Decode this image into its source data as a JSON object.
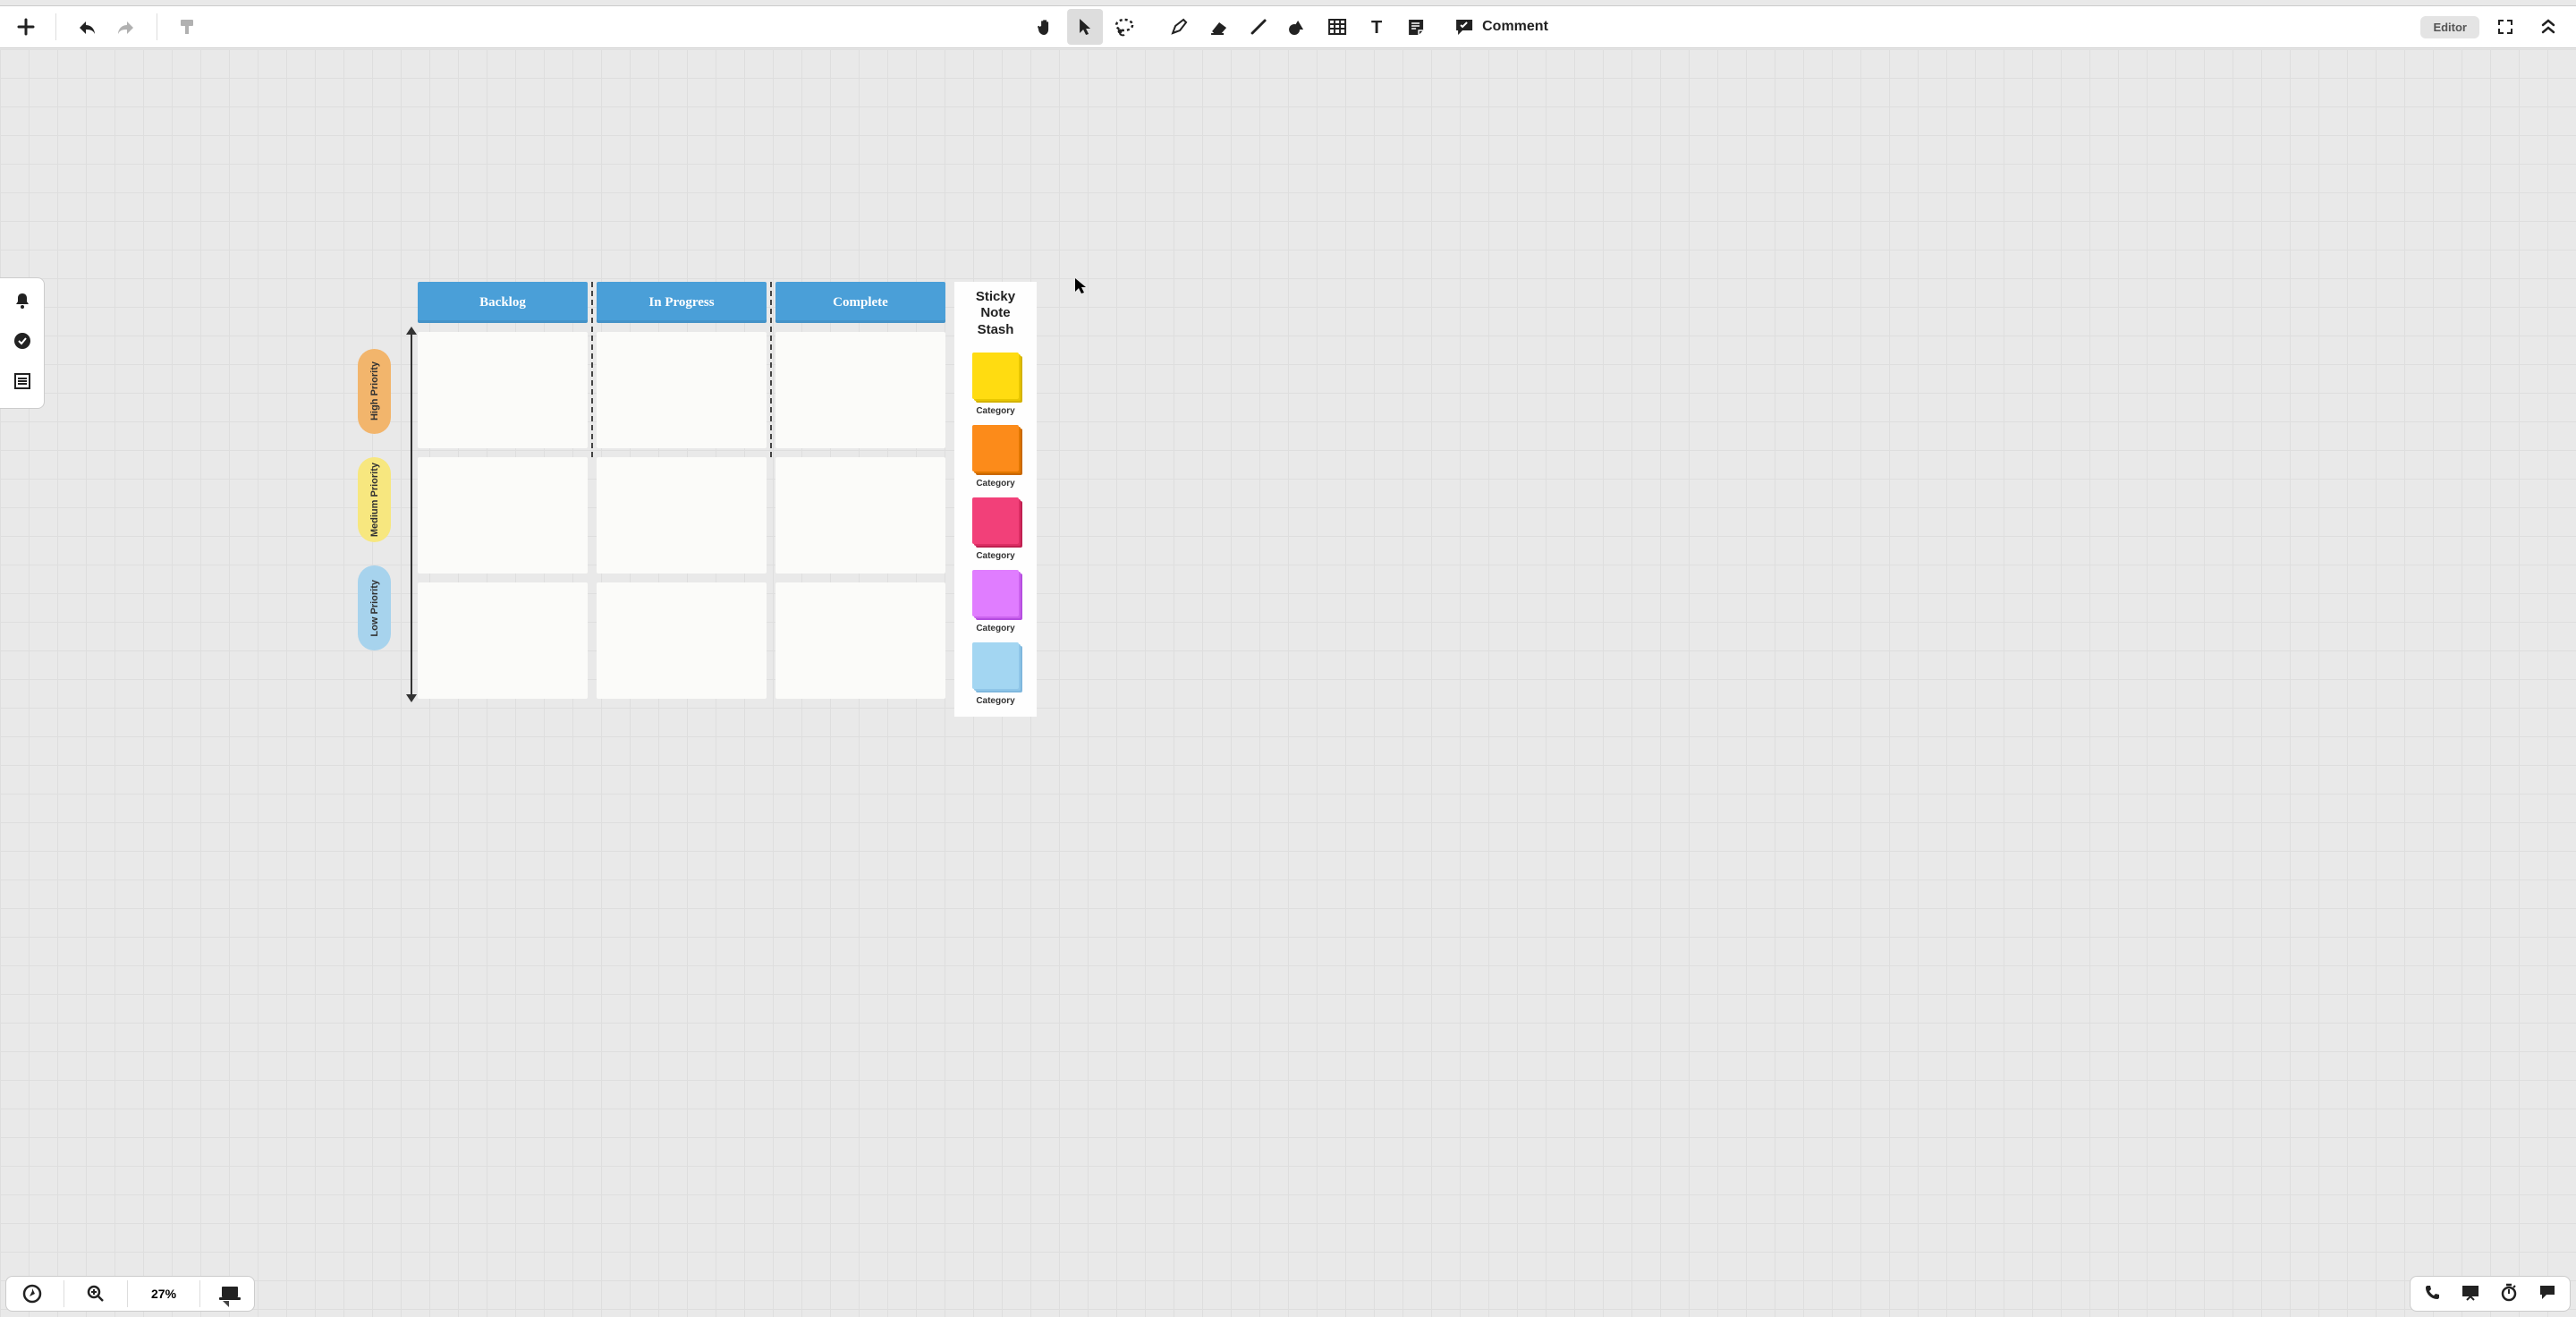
{
  "toolbar": {
    "comment_label": "Comment",
    "role_label": "Editor"
  },
  "zoom": {
    "level_text": "27%"
  },
  "board": {
    "columns": [
      "Backlog",
      "In Progress",
      "Complete"
    ],
    "priorities": [
      "High Priority",
      "Medium Priority",
      "Low Priority"
    ],
    "stash": {
      "title_l1": "Sticky",
      "title_l2": "Note",
      "title_l3": "Stash",
      "categories": [
        "Category",
        "Category",
        "Category",
        "Category",
        "Category"
      ]
    }
  }
}
